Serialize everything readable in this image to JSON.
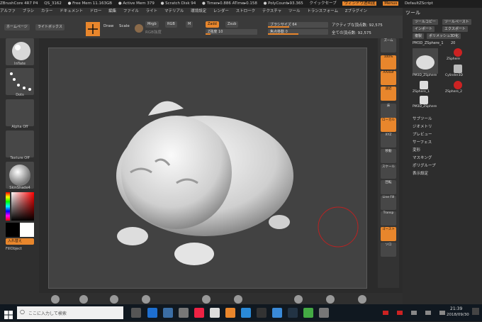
{
  "app": {
    "title_items": [
      "ZBrushCore 4R7 P4",
      "QS_3162",
      "● Free Mem 11.163GB",
      "● Active Mem 379",
      "● Scratch Disk 94",
      "● Timer▸0.886 ATime▸0.158",
      "● PolyCount▸93.365",
      "クイックセーブ",
      "ウィンドウ透明度",
      "Menus",
      "DefaultZScript"
    ]
  },
  "menu": [
    "アルファ",
    "ブラシ",
    "カラー",
    "ドキュメント",
    "ドロー",
    "編集",
    "ファイル",
    "ライト",
    "マテリアル",
    "環境設定",
    "レンダー",
    "ストローク",
    "テクスチャ",
    "ツール",
    "トランスフォーム",
    "Zプラグイン"
  ],
  "top": {
    "home": "ホームページ",
    "lightbox": "ライトボックス",
    "edit": "Edit",
    "draw": "Draw",
    "scale": "Scale",
    "rotate": "Rotate",
    "mrgb": "Mrgb",
    "rgb": "RGB",
    "m": "M",
    "rgb_intensity": "RGB強度",
    "zadd": "Zadd",
    "zsub": "Zsub",
    "z_intensity": "Z強度 10",
    "brush_size": "ブラシサイズ 64",
    "focal_shift": "焦点移動 0",
    "active_points": "アクティブな頂点数: 92,575",
    "total_points": "全ての頂点数: 92,575"
  },
  "left": {
    "brush": "Inflate",
    "stroke": "Dots",
    "alpha": "Alpha Off",
    "texture": "Texture Off",
    "material": "SkinShade4",
    "swap": "入れ替え",
    "fill": "FillObject"
  },
  "right_shelf": [
    "ズーム",
    "100%",
    "AAHalf",
    "遠近",
    "床",
    "ローカル",
    "XYZ",
    "移動",
    "スケール",
    "回転",
    "Line Fill",
    "Transp",
    "ゴースト",
    "ソロ"
  ],
  "tool_panel": {
    "title": "ツール",
    "copy": "ツールコピー",
    "paste": "ツールペースト",
    "import": "インポート",
    "export": "エクスポート",
    "clone": "複製",
    "polymesh": "ポリメッシュ3D化",
    "current_tool": "PM3D_ZSphere_1",
    "current_num": "20",
    "thumbs": [
      "PM3D_ZSphere",
      "ZSphere",
      "Cylinder3D",
      "ZSphere_1",
      "ZSphere_2",
      "PM3D_ZSphere"
    ],
    "sections": [
      "サブツール",
      "ジオメトリ",
      "プレビュー",
      "サーフェス",
      "変形",
      "マスキング",
      "ポリグループ",
      "表示設定"
    ]
  },
  "taskbar": {
    "search": "ここに入力して検索",
    "time": "21:39",
    "date": "2018/09/30"
  },
  "colors": {
    "accent": "#e8862c",
    "viewport": "#424242"
  }
}
